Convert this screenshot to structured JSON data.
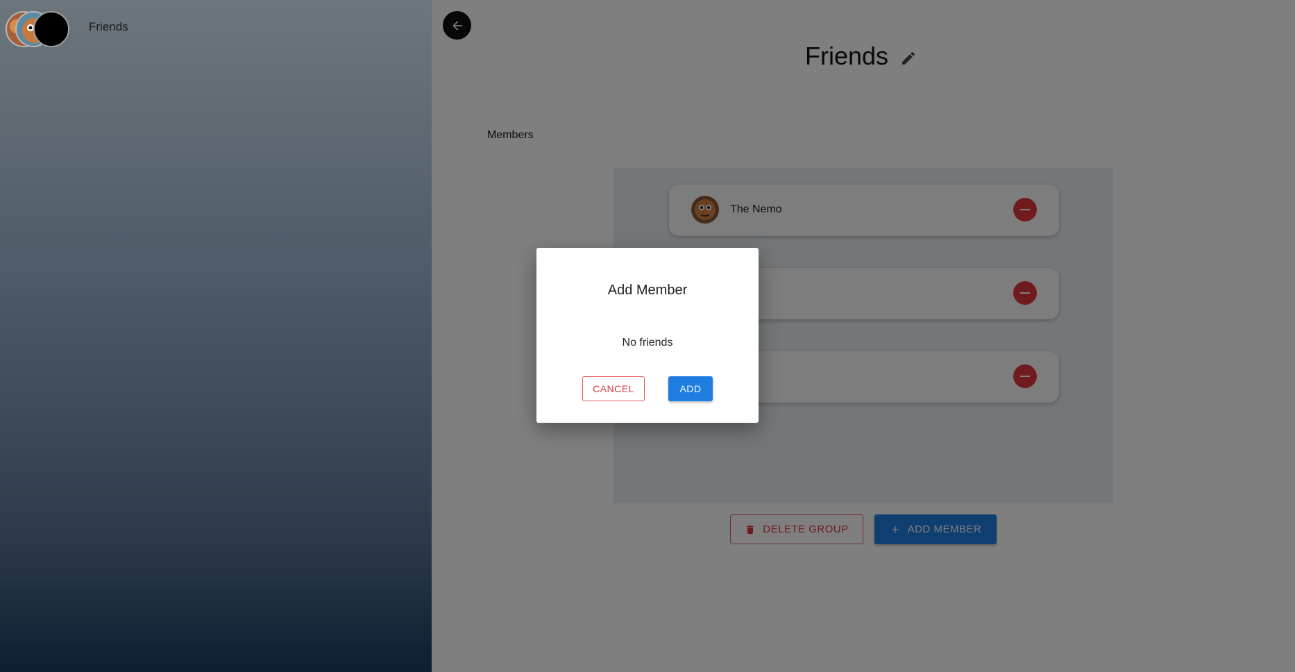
{
  "sidebar": {
    "groups": [
      {
        "name": "Friends"
      }
    ]
  },
  "header": {
    "title": "Friends"
  },
  "members": {
    "label": "Members",
    "list": [
      {
        "name": "The Nemo"
      },
      {
        "name": ""
      },
      {
        "name": ""
      }
    ]
  },
  "actions": {
    "delete_label": "DELETE GROUP",
    "add_member_label": "ADD MEMBER"
  },
  "dialog": {
    "title": "Add Member",
    "empty_text": "No friends",
    "cancel_label": "CANCEL",
    "add_label": "ADD"
  },
  "colors": {
    "primary": "#1f7ce0",
    "danger": "#d9393f",
    "remove": "#e0383f"
  }
}
